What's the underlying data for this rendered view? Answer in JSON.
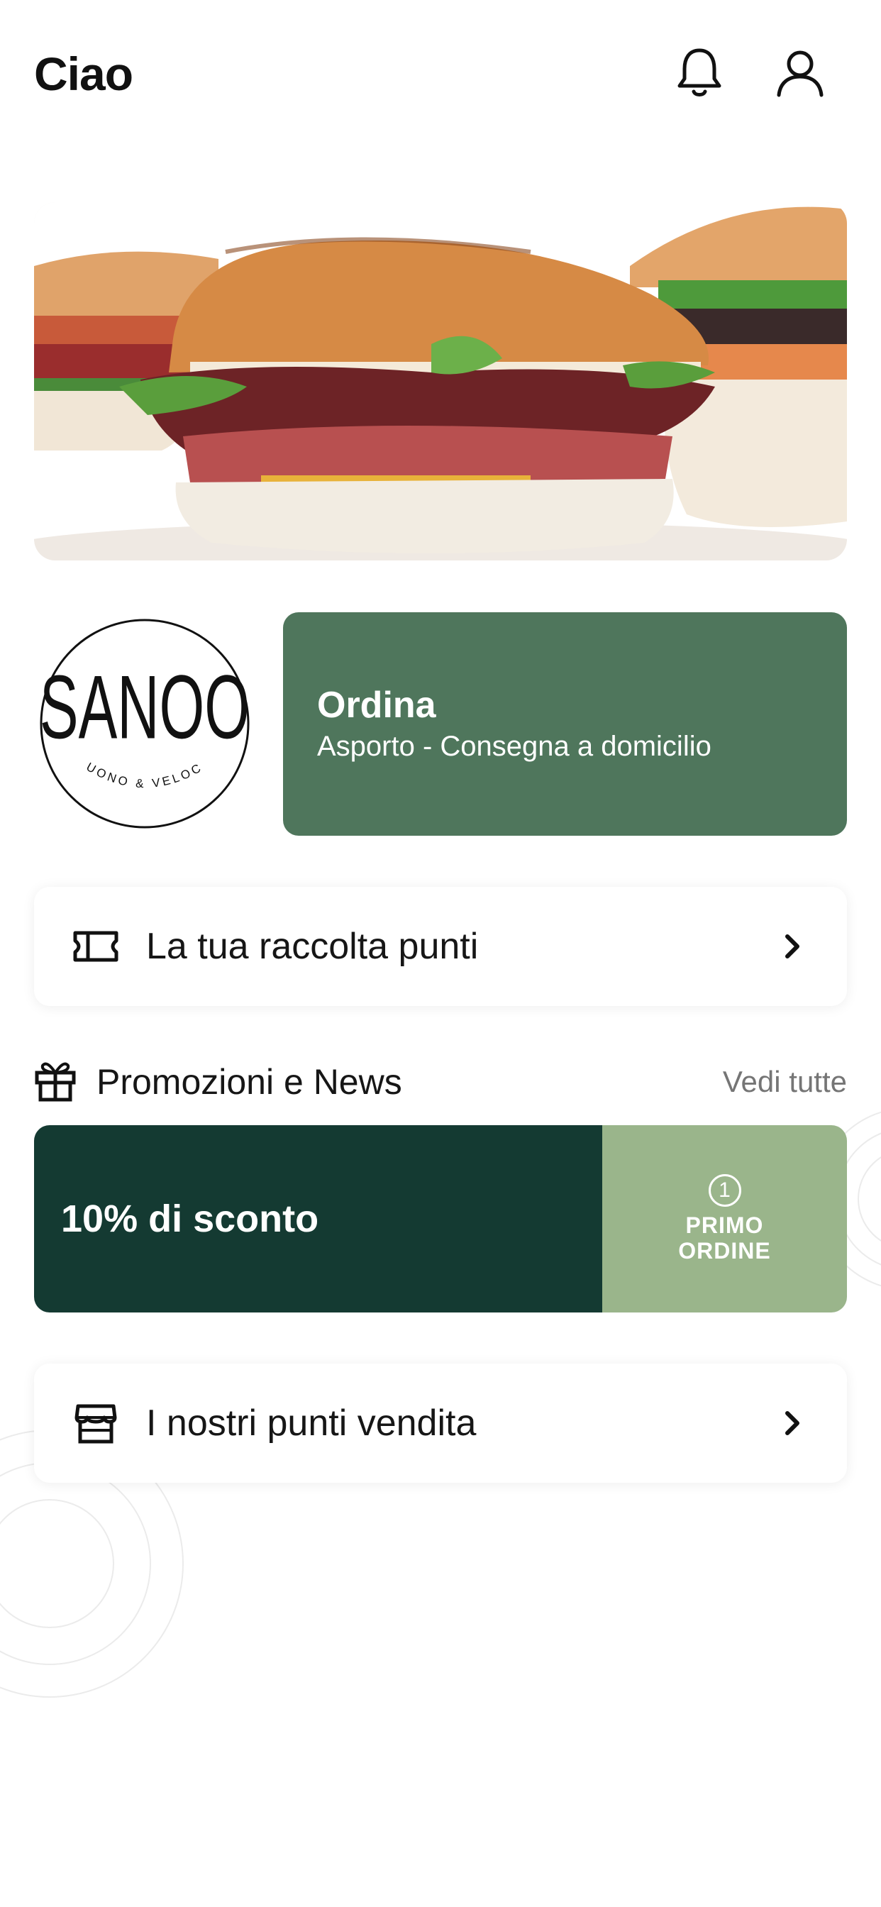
{
  "header": {
    "greeting": "Ciao",
    "icons": [
      "bell-icon",
      "user-icon"
    ]
  },
  "hero": {
    "image": "burger-photo"
  },
  "brand": {
    "name": "SANOO",
    "tagline": "BUONO & VELOCE"
  },
  "order_card": {
    "title": "Ordina",
    "subtitle": "Asporto - Consegna a domicilio",
    "color": "#4f765c"
  },
  "loyalty": {
    "label": "La tua raccolta punti",
    "icon": "ticket-icon"
  },
  "promotions": {
    "title": "Promozioni e News",
    "see_all": "Vedi tutte",
    "icon": "gift-icon",
    "banner": {
      "text": "10% di sconto",
      "badge_number": "1",
      "badge_line1": "PRIMO",
      "badge_line2": "ORDINE",
      "left_color": "#143a32",
      "right_color": "#9ab58b"
    }
  },
  "stores": {
    "label": "I nostri punti vendita",
    "icon": "store-icon"
  }
}
